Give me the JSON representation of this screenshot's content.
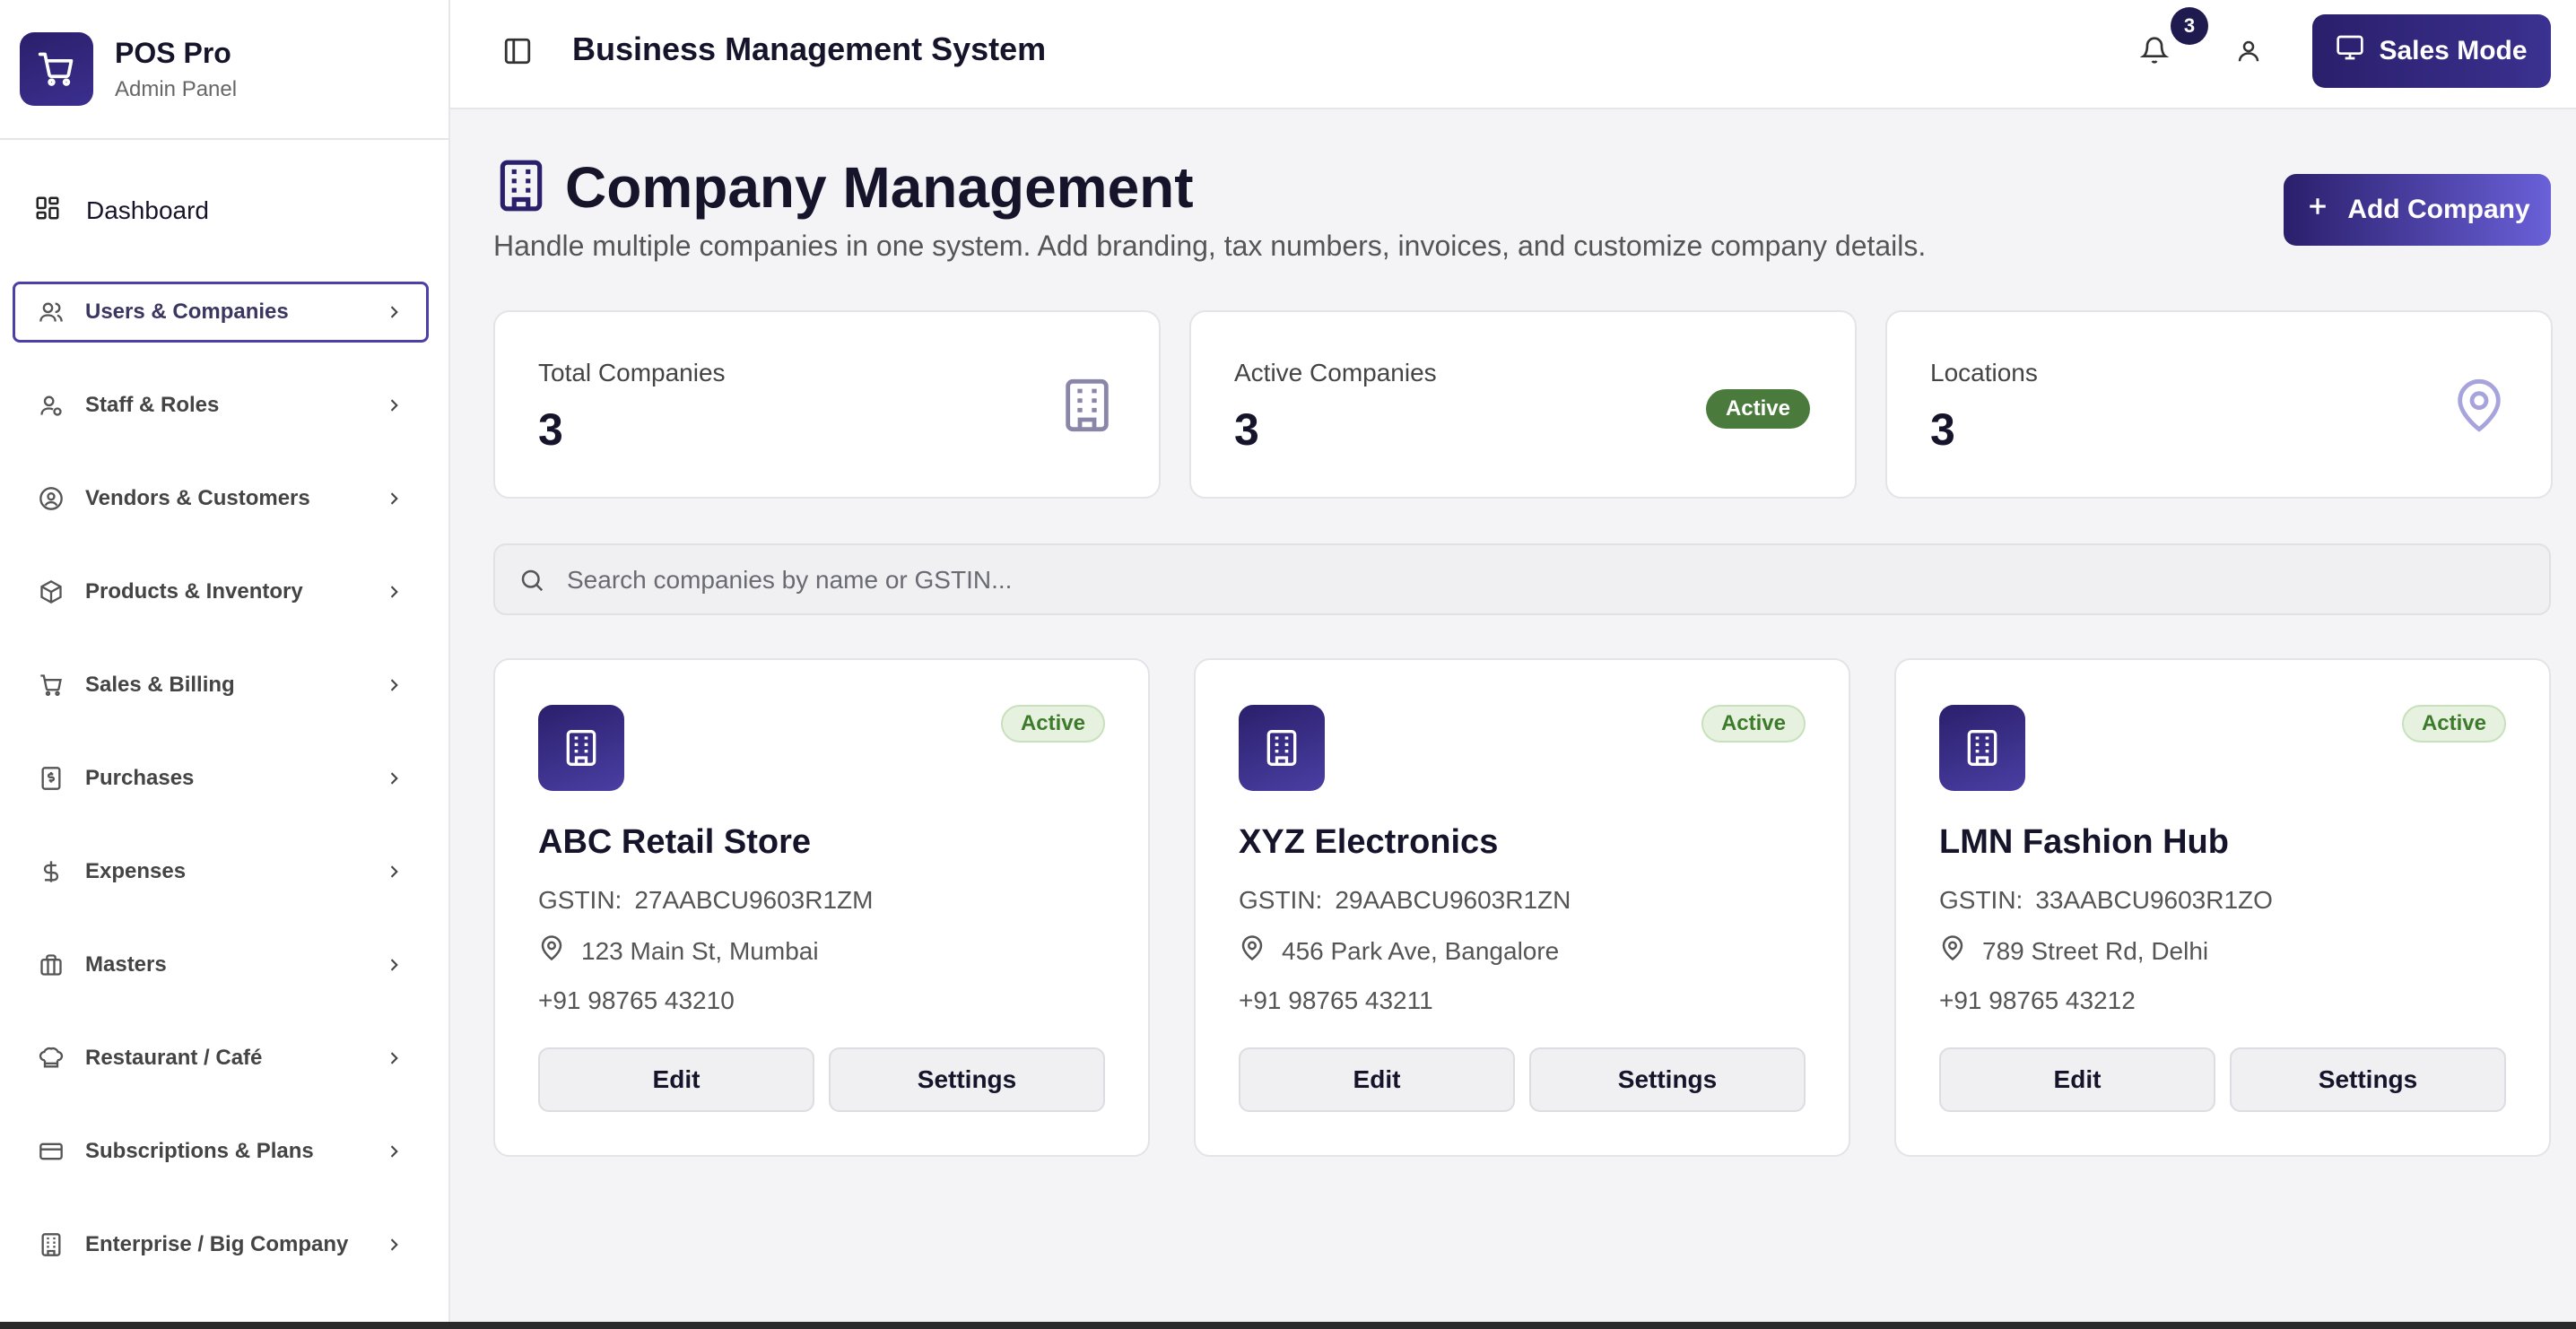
{
  "brand": {
    "title": "POS Pro",
    "subtitle": "Admin Panel"
  },
  "sidebar": {
    "dashboard": {
      "label": "Dashboard",
      "icon": "dashboard-grid-icon"
    },
    "items": [
      {
        "label": "Users & Companies",
        "icon": "users-icon",
        "active": true
      },
      {
        "label": "Staff & Roles",
        "icon": "user-cog-icon"
      },
      {
        "label": "Vendors & Customers",
        "icon": "user-circle-icon"
      },
      {
        "label": "Products & Inventory",
        "icon": "box-icon"
      },
      {
        "label": "Sales & Billing",
        "icon": "cart-icon"
      },
      {
        "label": "Purchases",
        "icon": "receipt-icon"
      },
      {
        "label": "Expenses",
        "icon": "dollar-icon"
      },
      {
        "label": "Masters",
        "icon": "briefcase-icon"
      },
      {
        "label": "Restaurant / Café",
        "icon": "chef-hat-icon"
      },
      {
        "label": "Subscriptions & Plans",
        "icon": "credit-card-icon"
      },
      {
        "label": "Enterprise / Big Company",
        "icon": "building-icon"
      }
    ]
  },
  "header": {
    "title": "Business Management System",
    "notifications_count": "3",
    "sales_mode_label": "Sales Mode"
  },
  "page": {
    "title": "Company Management",
    "subtitle": "Handle multiple companies in one system. Add branding, tax numbers, invoices, and customize company details.",
    "add_label": "Add Company"
  },
  "stats": [
    {
      "label": "Total Companies",
      "value": "3",
      "icon": "building-icon"
    },
    {
      "label": "Active Companies",
      "value": "3",
      "badge": "Active"
    },
    {
      "label": "Locations",
      "value": "3",
      "icon": "map-pin-icon"
    }
  ],
  "search": {
    "placeholder": "Search companies by name or GSTIN..."
  },
  "companies": [
    {
      "name": "ABC Retail Store",
      "status": "Active",
      "gstin_label": "GSTIN:",
      "gstin": "27AABCU9603R1ZM",
      "address": "123 Main St, Mumbai",
      "phone": "+91 98765 43210",
      "edit_label": "Edit",
      "settings_label": "Settings"
    },
    {
      "name": "XYZ Electronics",
      "status": "Active",
      "gstin_label": "GSTIN:",
      "gstin": "29AABCU9603R1ZN",
      "address": "456 Park Ave, Bangalore",
      "phone": "+91 98765 43211",
      "edit_label": "Edit",
      "settings_label": "Settings"
    },
    {
      "name": "LMN Fashion Hub",
      "status": "Active",
      "gstin_label": "GSTIN:",
      "gstin": "33AABCU9603R1ZO",
      "address": "789 Street Rd, Delhi",
      "phone": "+91 98765 43212",
      "edit_label": "Edit",
      "settings_label": "Settings"
    }
  ],
  "colors": {
    "accent": "#2a1f6b",
    "active_badge": "#4a7a3c",
    "active_soft": "#e6f2df"
  }
}
